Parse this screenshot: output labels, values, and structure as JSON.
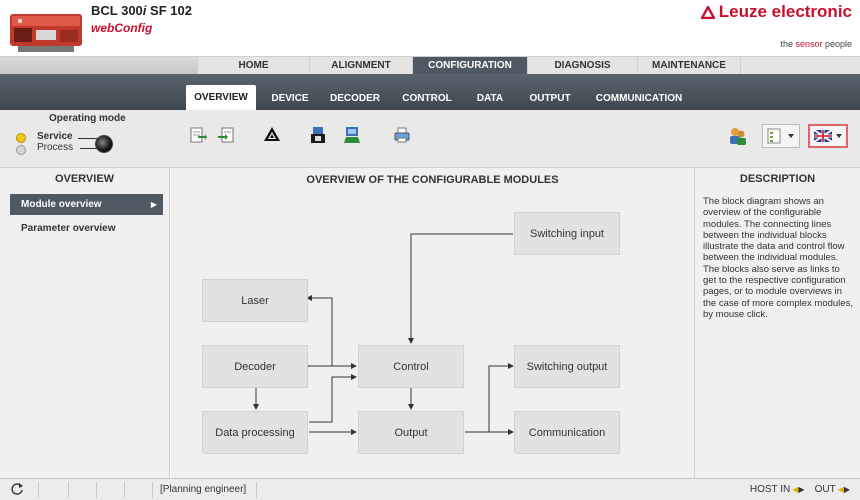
{
  "header": {
    "product": "BCL 300",
    "product_i": "i",
    "product_suffix": " SF 102",
    "app": "webConfig",
    "brand": "Leuze electronic",
    "tagline_pre": "the ",
    "tagline_sensor": "sensor",
    "tagline_post": " people"
  },
  "main_nav": {
    "tabs": [
      "HOME",
      "ALIGNMENT",
      "CONFIGURATION",
      "DIAGNOSIS",
      "MAINTENANCE"
    ],
    "active": "CONFIGURATION"
  },
  "sub_nav": {
    "tabs": [
      "OVERVIEW",
      "DEVICE",
      "DECODER",
      "CONTROL",
      "DATA",
      "OUTPUT",
      "COMMUNICATION"
    ],
    "active": "OVERVIEW"
  },
  "operating_mode": {
    "title": "Operating mode",
    "service": "Service",
    "process": "Process",
    "selected": "Service"
  },
  "toolbar": {
    "icons": [
      "upload-to-device-icon",
      "download-from-device-icon",
      "recycle-icon",
      "save-icon",
      "open-icon",
      "print-icon"
    ],
    "right_icons": [
      "user-icon",
      "view-menu-icon",
      "language-flag-icon"
    ]
  },
  "left_panel": {
    "title": "OVERVIEW",
    "items": [
      "Module overview",
      "Parameter overview"
    ],
    "active": "Module overview"
  },
  "center": {
    "title": "OVERVIEW OF THE CONFIGURABLE MODULES",
    "blocks": {
      "switching_input": "Switching input",
      "laser": "Laser",
      "decoder": "Decoder",
      "control": "Control",
      "switching_output": "Switching output",
      "data_processing": "Data processing",
      "output": "Output",
      "communication": "Communication"
    }
  },
  "right_panel": {
    "title": "DESCRIPTION",
    "text": "The block diagram shows an overview of the configurable modules. The connecting lines between the individual blocks illustrate the data and control flow between the individual modules. The blocks also serve as links to get to the respective configuration pages, or to module overviews in the case of more complex modules, by mouse click."
  },
  "status_bar": {
    "role": "[Planning engineer]",
    "host_in": "HOST IN",
    "out": "OUT"
  },
  "colors": {
    "brand_red": "#c8102e",
    "nav_dark": "#4f5963",
    "led_service": "#f5c518"
  }
}
